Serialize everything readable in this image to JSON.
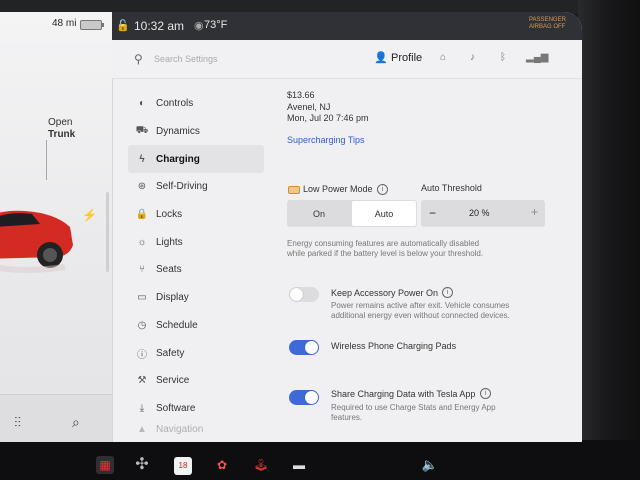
{
  "status": {
    "time": "10:32 am",
    "temperature": "73°F",
    "range": "48 mi",
    "passenger_airbag": "PASSENGER AIRBAG OFF"
  },
  "car_panel": {
    "trunk_action": "Open",
    "trunk_label": "Trunk"
  },
  "search": {
    "placeholder": "Search Settings"
  },
  "profile": {
    "label": "Profile"
  },
  "menu": {
    "items": [
      {
        "label": "Controls",
        "icon": "toggle-icon"
      },
      {
        "label": "Dynamics",
        "icon": "car-icon"
      },
      {
        "label": "Charging",
        "icon": "bolt-icon"
      },
      {
        "label": "Self-Driving",
        "icon": "steering-wheel-icon"
      },
      {
        "label": "Locks",
        "icon": "lock-icon"
      },
      {
        "label": "Lights",
        "icon": "light-icon"
      },
      {
        "label": "Seats",
        "icon": "seat-icon"
      },
      {
        "label": "Display",
        "icon": "display-icon"
      },
      {
        "label": "Schedule",
        "icon": "clock-icon"
      },
      {
        "label": "Safety",
        "icon": "safety-icon"
      },
      {
        "label": "Service",
        "icon": "wrench-icon"
      },
      {
        "label": "Software",
        "icon": "download-icon"
      },
      {
        "label": "Navigation",
        "icon": "navigation-icon"
      }
    ],
    "active": "Charging"
  },
  "charging": {
    "last_session_cost": "$13.66",
    "last_session_location": "Avenel, NJ",
    "last_session_date": "Mon, Jul 20 7:46 pm",
    "supercharging_tips": "Supercharging Tips",
    "low_power_mode_label": "Low Power Mode",
    "auto_threshold_label": "Auto Threshold",
    "mode_on": "On",
    "mode_auto": "Auto",
    "threshold_value": "20 %",
    "low_power_description_1": "Energy consuming features are automatically disabled",
    "low_power_description_2": "while parked if the battery level is below your threshold.",
    "keep_accessory_label": "Keep Accessory Power On",
    "keep_accessory_desc_1": "Power remains active after exit. Vehicle consumes",
    "keep_accessory_desc_2": "additional energy even without connected devices.",
    "keep_accessory_on": false,
    "wireless_pads_label": "Wireless Phone Charging Pads",
    "wireless_pads_on": true,
    "share_data_label": "Share Charging Data with Tesla App",
    "share_data_desc_1": "Required to use Charge Stats and Energy App",
    "share_data_desc_2": "features.",
    "share_data_on": true
  },
  "taskbar": {
    "calendar_day": "18"
  },
  "colors": {
    "accent": "#3e6ad8",
    "link": "#2f60c8",
    "car": "#d42a24"
  }
}
